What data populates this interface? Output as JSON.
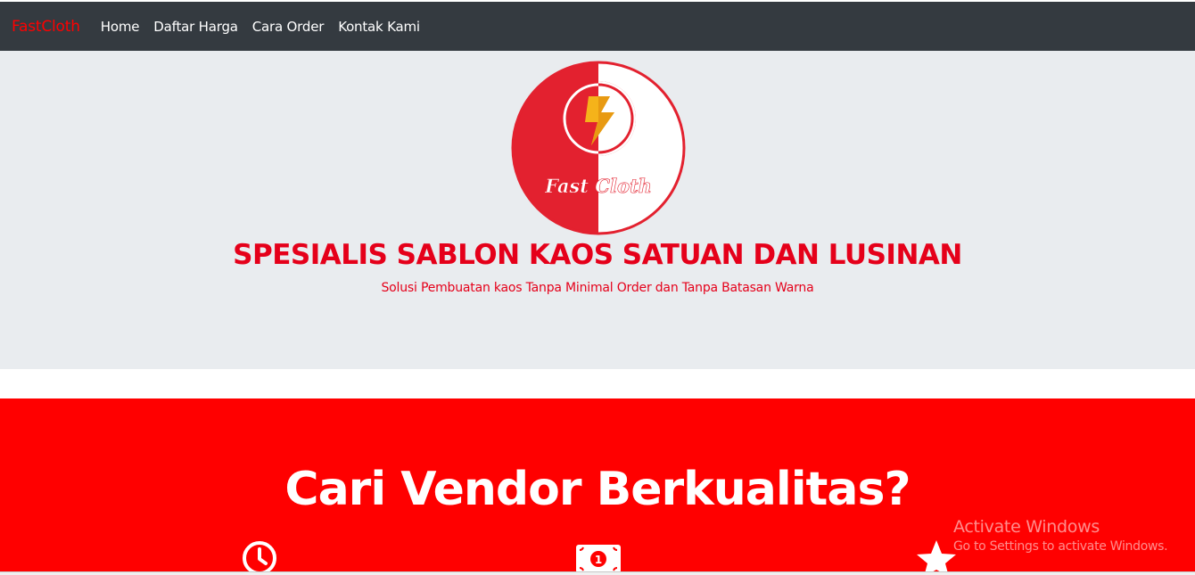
{
  "navbar": {
    "brand": "FastCloth",
    "links": [
      "Home",
      "Daftar Harga",
      "Cara Order",
      "Kontak Kami"
    ]
  },
  "hero": {
    "logo_text": "Fast Cloth",
    "title": "SPESIALIS SABLON KAOS SATUAN DAN LUSINAN",
    "subtitle": "Solusi Pembuatan kaos Tanpa Minimal Order dan Tanpa Batasan Warna"
  },
  "section": {
    "title": "Cari Vendor Berkualitas?",
    "features": [
      {
        "icon": "clock-icon"
      },
      {
        "icon": "money-bill-icon",
        "label": "1"
      },
      {
        "icon": "star-icon"
      }
    ]
  },
  "watermark": {
    "title": "Activate Windows",
    "subtitle": "Go to Settings to activate Windows."
  },
  "colors": {
    "brand_red": "#ff0000",
    "navbar_bg": "#343a40",
    "hero_bg": "#e9ecef",
    "logo_red": "#e3212f",
    "bolt_yellow": "#f5b31a"
  }
}
